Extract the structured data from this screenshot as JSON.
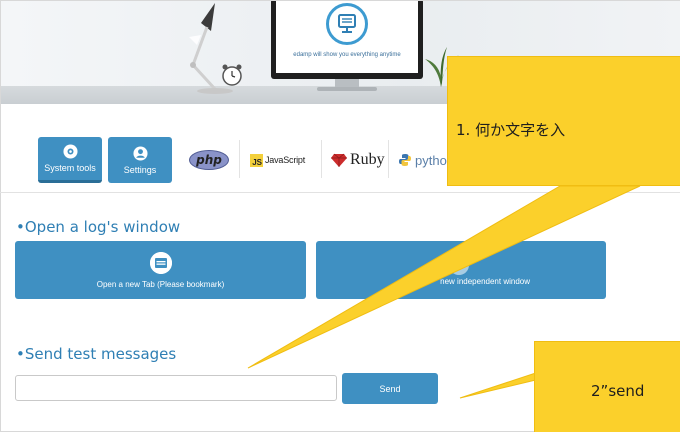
{
  "hero": {
    "tagline": "edamp will show you everything anytime",
    "icons": [
      "desk-lamp-icon",
      "alarm-clock-icon",
      "plant-icon",
      "monitor-logo-icon"
    ]
  },
  "toolbar": {
    "buttons": [
      {
        "label": "System tools",
        "icon": "gear-icon"
      },
      {
        "label": "Settings",
        "icon": "user-icon"
      }
    ],
    "languages": {
      "php": "php",
      "js_mark": "JS",
      "js_word": "JavaScript",
      "ruby": "Ruby",
      "python": "pytho"
    }
  },
  "log_section": {
    "title": "Open a log's window",
    "bullet": "•",
    "buttons": [
      {
        "label": "Open a new Tab (Please bookmark)",
        "icon": "browser-tab-icon"
      },
      {
        "label": "new independent window",
        "icon": "window-icon"
      }
    ]
  },
  "test_section": {
    "title": "Send test messages",
    "bullet": "•",
    "input_value": "",
    "send_label": "Send"
  },
  "callouts": [
    {
      "text": "1. 何か文字を入"
    },
    {
      "text": "2”send"
    }
  ],
  "colors": {
    "accent": "#3f90c2",
    "heading": "#2f7fb4",
    "callout": "#fbd02b"
  }
}
